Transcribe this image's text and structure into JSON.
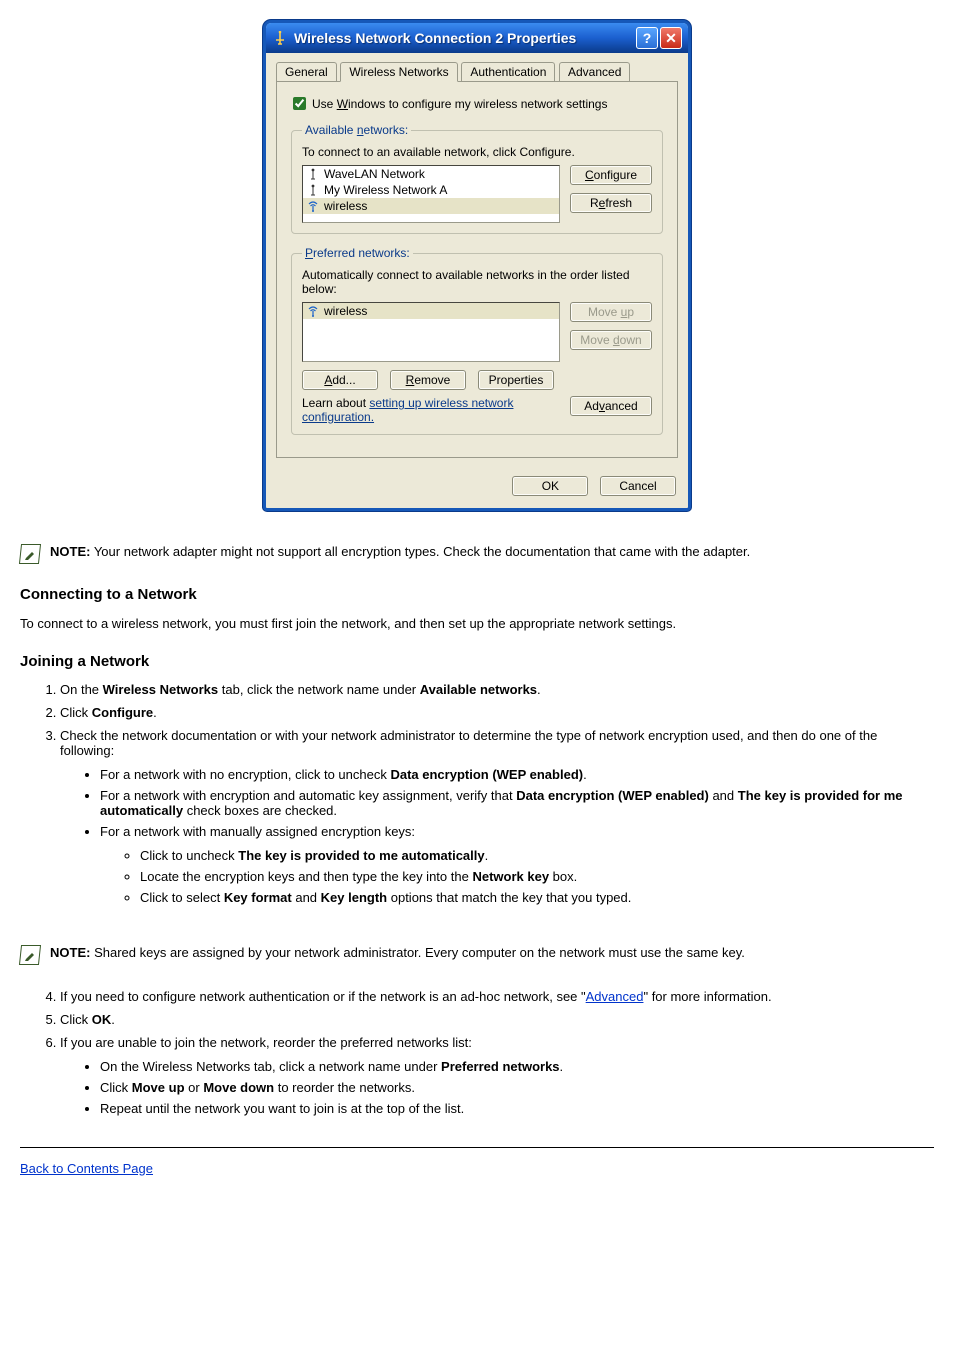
{
  "screenshot": {
    "title": "Wireless Network Connection 2 Properties",
    "help_btn": "?",
    "close_btn": "✕",
    "tabs": {
      "general": "General",
      "wireless": "Wireless Networks",
      "auth": "Authentication",
      "advanced": "Advanced"
    },
    "checkbox_label_pre": "Use ",
    "checkbox_label_accel": "W",
    "checkbox_label_post": "indows to configure my wireless network settings",
    "available": {
      "legend_pre": "Available ",
      "legend_accel": "n",
      "legend_post": "etworks:",
      "hint": "To connect to an available network, click Configure.",
      "items": [
        {
          "name": "WaveLAN Network",
          "icon": "antenna"
        },
        {
          "name": "My Wireless Network A",
          "icon": "antenna"
        },
        {
          "name": "wireless",
          "icon": "signal"
        }
      ],
      "btn_configure_accel": "C",
      "btn_configure_post": "onfigure",
      "btn_refresh_pre": "R",
      "btn_refresh_accel": "e",
      "btn_refresh_post": "fresh"
    },
    "preferred": {
      "legend_accel": "P",
      "legend_post": "referred networks:",
      "hint": "Automatically connect to available networks in the order listed below:",
      "items": [
        {
          "name": "wireless",
          "icon": "signal"
        }
      ],
      "btn_moveup_pre": "Move ",
      "btn_moveup_accel": "u",
      "btn_moveup_post": "p",
      "btn_movedown_pre": "Move ",
      "btn_movedown_accel": "d",
      "btn_movedown_post": "own",
      "btn_add_accel": "A",
      "btn_add_post": "dd...",
      "btn_remove_accel": "R",
      "btn_remove_post": "emove",
      "btn_properties": "Properties"
    },
    "learn_pre": "Learn about ",
    "learn_link": "setting up wireless network configuration.",
    "btn_advanced_pre": "Ad",
    "btn_advanced_accel": "v",
    "btn_advanced_post": "anced",
    "ok": "OK",
    "cancel": "Cancel"
  },
  "doc": {
    "note1_label": "NOTE:",
    "note1_text": " Your network adapter might not support all encryption types. Check the documentation that came with the adapter.",
    "heading_connecting": "Connecting to a Network",
    "intro_connecting": "To connect to a wireless network, you must first join the network, and then set up the appropriate network settings.",
    "heading_joining": "Joining a Network",
    "steps_join": [
      {
        "pre": "On the ",
        "b1": "Wireless Networks",
        "mid1": " tab, click the network name under ",
        "b2": "Available networks",
        "post": "."
      },
      {
        "pre": "Click ",
        "b1": "Configure",
        "post": "."
      }
    ],
    "step3_text": "Check the network documentation or with your network administrator to determine the type of network encryption used, and then do one of the following:",
    "sub_items": [
      {
        "line": {
          "pre": "For a network with no encryption, click to uncheck ",
          "b1": "Data encryption (WEP enabled)",
          "post": "."
        }
      },
      {
        "line": {
          "pre": "For a network with encryption and automatic key assignment, verify that ",
          "b1": "Data encryption (WEP enabled)",
          "mid1": " and ",
          "b2": "The key is provided for me automatically",
          "post": " check boxes are checked."
        }
      },
      {
        "line": {
          "text": "For a network with manually assigned encryption keys:"
        },
        "sub2": [
          {
            "pre": "Click to uncheck ",
            "b1": "The key is provided to me automatically",
            "post": "."
          },
          {
            "pre": "Locate the encryption keys and then type the key into the ",
            "b1": "Network key",
            "post": " box."
          },
          {
            "pre": "Click to select ",
            "b1": "Key format",
            "mid1": " and ",
            "b2": "Key length",
            "post": " options that match the key that you typed."
          }
        ]
      }
    ],
    "note2_label": "NOTE:",
    "note2_text": " Shared keys are assigned by your network administrator. Every computer on the network must use the same key.",
    "step4": {
      "pre": "If you need to configure network authentication or if the network is an ad-hoc network, see \"",
      "link": "Advanced",
      "post": "\" for more information."
    },
    "step5": {
      "pre": "Click ",
      "b1": "OK",
      "post": "."
    },
    "step6_text": "If you are unable to join the network, reorder the preferred networks list:",
    "step6_sub": [
      {
        "pre": "On the Wireless Networks tab, click a network name under ",
        "b1": "Preferred networks",
        "post": "."
      },
      {
        "pre": "Click ",
        "b1": "Move up",
        "mid1": " or ",
        "b2": "Move down",
        "post": " to reorder the networks."
      },
      {
        "text": "Repeat until the network you want to join is at the top of the list."
      }
    ],
    "back_link": "Back to Contents Page"
  }
}
